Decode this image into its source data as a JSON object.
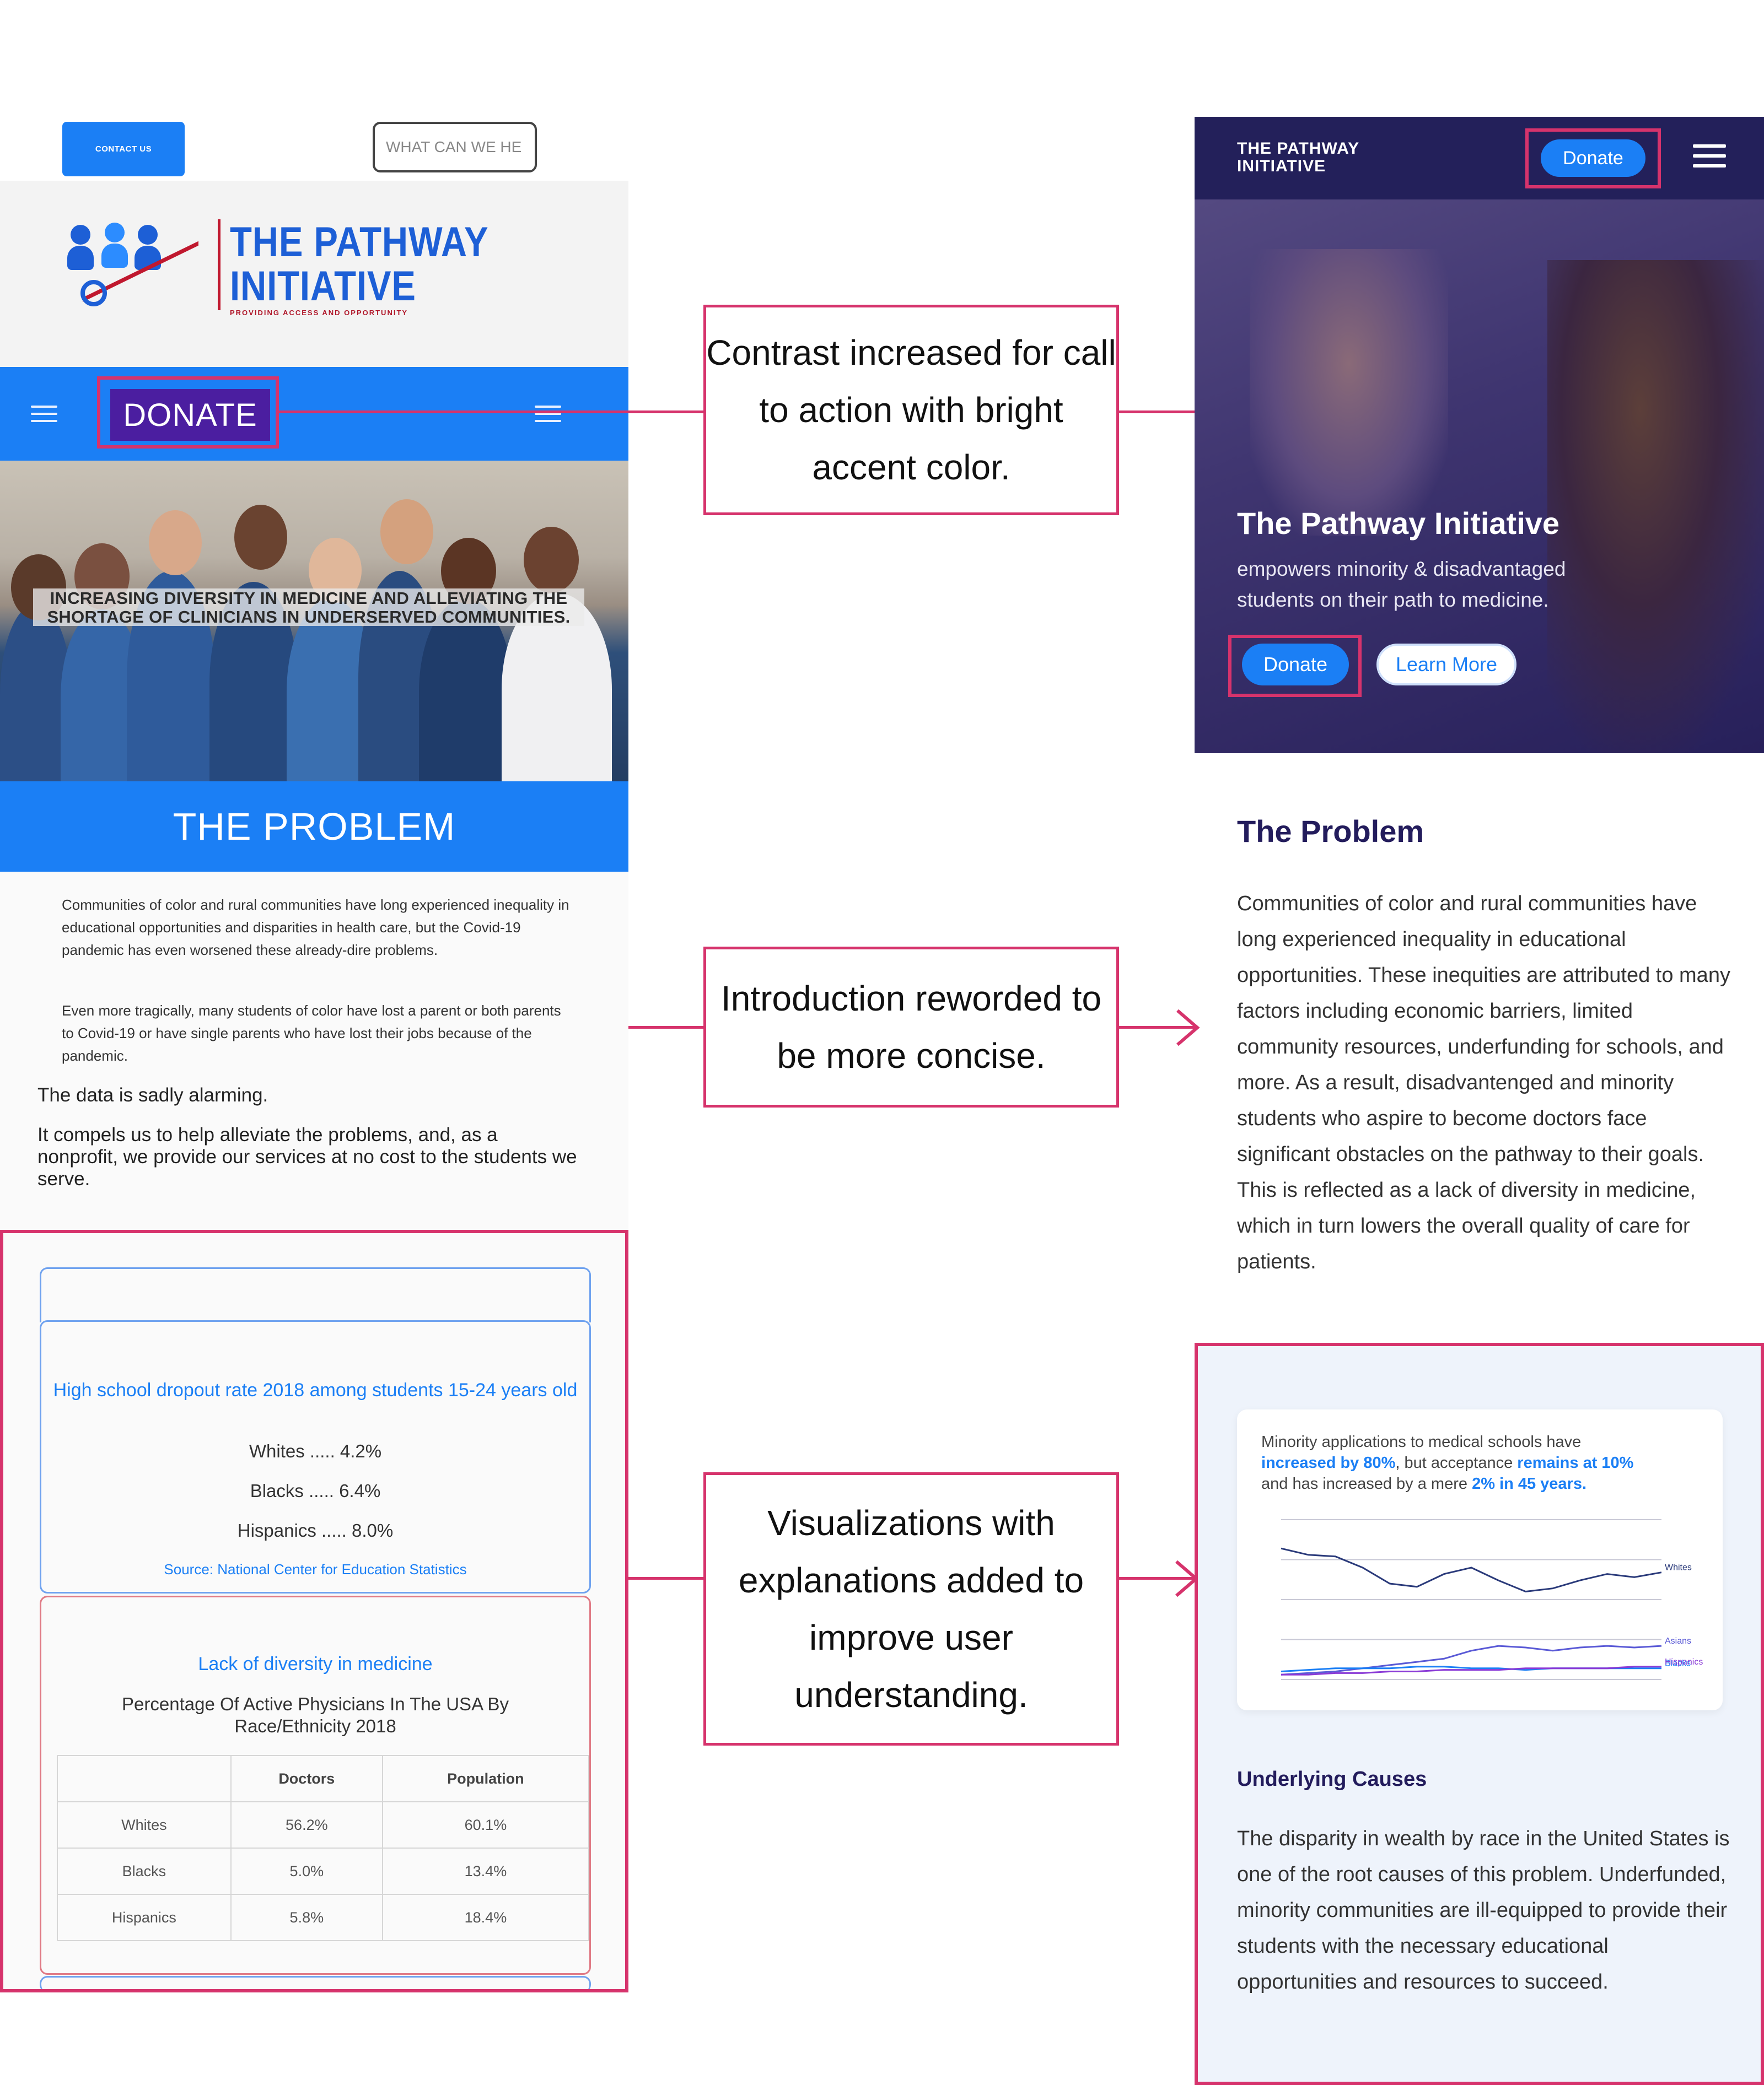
{
  "left": {
    "contact_label": "CONTACT US",
    "what_label": "WHAT CAN WE HE",
    "logo_title_line1": "THE PATHWAY",
    "logo_title_line2": "INITIATIVE",
    "logo_tagline": "PROVIDING ACCESS AND OPPORTUNITY",
    "donate_label": "DONATE",
    "hero_caption": "INCREASING DIVERSITY IN MEDICINE AND ALLEVIATING THE SHORTAGE OF CLINICIANS IN UNDERSERVED COMMUNITIES.",
    "problem_heading": "THE PROBLEM",
    "para1": "Communities of color and rural communities have long experienced inequality in educational opportunities and disparities in health care, but the Covid-19 pandemic has even worsened these already-dire problems.",
    "para2": "Even more tragically, many students of color have lost a parent or both parents to Covid-19 or have single parents who have lost their jobs because of the pandemic.",
    "para3": "The data is sadly alarming.",
    "para4": "It compels us to help alleviate the problems, and, as a nonprofit, we provide our services at no cost to the students we serve.",
    "card1": {
      "title": "High school dropout rate 2018 among students 15-24 years old",
      "rows": [
        "Whites ..... 4.2%",
        "Blacks ..... 6.4%",
        "Hispanics ..... 8.0%"
      ],
      "source": "Source: National Center for Education Statistics"
    },
    "card2": {
      "title": "Lack of diversity in medicine",
      "subtitle": "Percentage Of Active Physicians In The USA By Race/Ethnicity 2018",
      "headers": [
        "",
        "Doctors",
        "Population"
      ],
      "rows": [
        [
          "Whites",
          "56.2%",
          "60.1%"
        ],
        [
          "Blacks",
          "5.0%",
          "13.4%"
        ],
        [
          "Hispanics",
          "5.8%",
          "18.4%"
        ]
      ]
    }
  },
  "callouts": {
    "c1": "Contrast increased for call to action with bright accent color.",
    "c2": "Introduction reworded to be more concise.",
    "c3": "Visualizations with explanations added to improve user understanding."
  },
  "right": {
    "logo_line1": "THE PATHWAY",
    "logo_line2": "INITIATIVE",
    "donate_top": "Donate",
    "hero_title": "The Pathway Initiative",
    "hero_sub": "empowers minority & disadvantaged students on their path to medicine.",
    "donate_label": "Donate",
    "learn_label": "Learn More",
    "problem_title": "The Problem",
    "problem_body": "Communities of color and rural communities have long experienced inequality in educational opportunities. These inequities are attributed to many factors including economic barriers, limited community resources, underfunding for schools, and more.  As a result, disadvantenged and minority students who aspire to become doctors face significant obstacles on the pathway to their goals. This is reflected as a lack of diversity in medicine, which in turn lowers the overall quality of care for patients.",
    "chart_text_1": "Minority applications to medical schools have",
    "chart_text_2a": "increased by 80%",
    "chart_text_2b": ", but acceptance ",
    "chart_text_2c": "remains at 10%",
    "chart_text_3a": "and has increased by a mere ",
    "chart_text_3b": "2% in 45 years.",
    "causes_title": "Underlying Causes",
    "causes_body": "The disparity in wealth by race in the United States is one of the root causes of this problem. Underfunded, minority communities are ill-equipped to provide their students with the necessary educational opportunities and resources to succeed."
  },
  "chart_data": {
    "type": "line",
    "title": "",
    "series": [
      {
        "name": "Whites",
        "values": [
          82,
          78,
          77,
          70,
          60,
          58,
          66,
          70,
          62,
          55,
          57,
          62,
          66,
          64,
          67
        ]
      },
      {
        "name": "Asians",
        "values": [
          3,
          4,
          5,
          7,
          9,
          11,
          13,
          18,
          21,
          20,
          18,
          20,
          21,
          20,
          21
        ]
      },
      {
        "name": "Blacks",
        "values": [
          5,
          6,
          7,
          7,
          7,
          8,
          8,
          7,
          7,
          6,
          7,
          7,
          7,
          7,
          7
        ]
      },
      {
        "name": "Hispanics",
        "values": [
          3,
          3,
          4,
          4,
          5,
          5,
          6,
          6,
          6,
          7,
          7,
          7,
          7,
          8,
          8
        ]
      }
    ],
    "colors": {
      "Whites": "#2a3a7a",
      "Asians": "#5a5ad6",
      "Blacks": "#1b7ff5",
      "Hispanics": "#8a3ad6"
    },
    "ylim": [
      0,
      100
    ],
    "grid": true
  },
  "colors": {
    "accent": "#1b7ff5",
    "callout": "#d6336c",
    "navy": "#23205a",
    "old_donate": "#4b1ea0"
  }
}
